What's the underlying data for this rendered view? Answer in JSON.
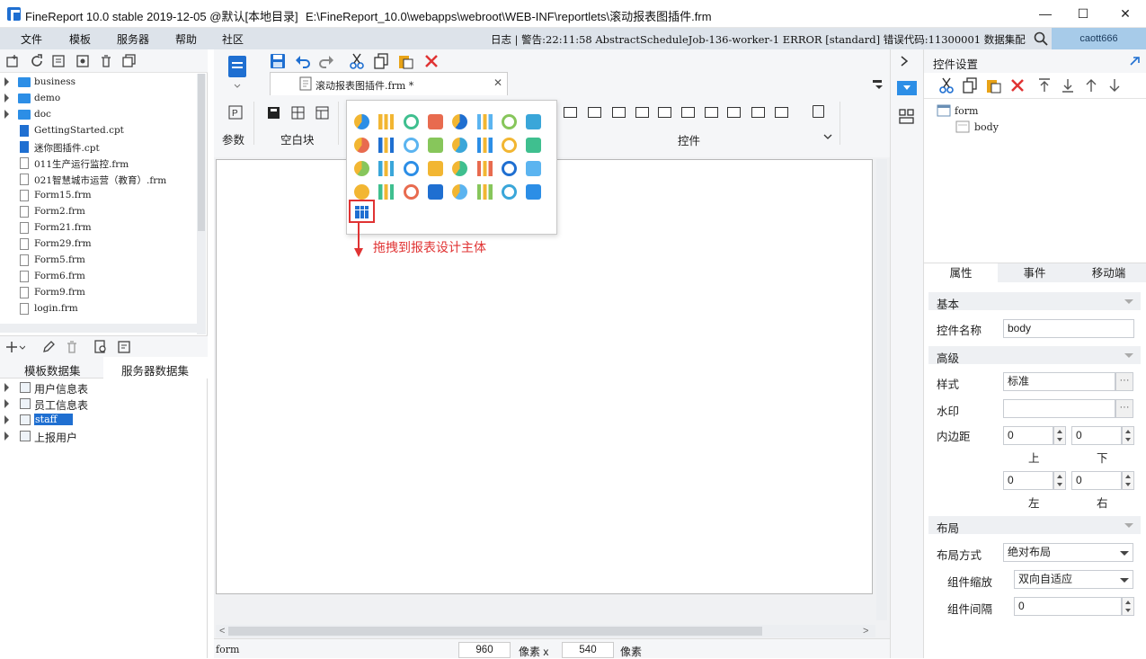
{
  "window": {
    "title": "FineReport 10.0 stable 2019-12-05 @默认[本地目录]",
    "path": "E:\\FineReport_10.0\\webapps\\webroot\\WEB-INF\\reportlets\\滚动报表图插件.frm",
    "min": "—",
    "max": "☐",
    "close": "✕"
  },
  "menubar": {
    "items": [
      "文件",
      "模板",
      "服务器",
      "帮助",
      "社区"
    ],
    "log": "日志 | 警告:22:11:58 AbstractScheduleJob-136-worker-1 ERROR [standard] 错误代码:11300001 数据集配...",
    "user": "caott666"
  },
  "tree": {
    "items": [
      {
        "label": "business",
        "type": "folder"
      },
      {
        "label": "demo",
        "type": "folder"
      },
      {
        "label": "doc",
        "type": "folder"
      },
      {
        "label": "GettingStarted.cpt",
        "type": "cpt"
      },
      {
        "label": "迷你图插件.cpt",
        "type": "cpt"
      },
      {
        "label": "011生产运行监控.frm",
        "type": "frm"
      },
      {
        "label": "021智慧城市运营（教育）.frm",
        "type": "frm"
      },
      {
        "label": "Form15.frm",
        "type": "frm"
      },
      {
        "label": "Form2.frm",
        "type": "frm"
      },
      {
        "label": "Form21.frm",
        "type": "frm"
      },
      {
        "label": "Form29.frm",
        "type": "frm"
      },
      {
        "label": "Form5.frm",
        "type": "frm"
      },
      {
        "label": "Form6.frm",
        "type": "frm"
      },
      {
        "label": "Form9.frm",
        "type": "frm"
      },
      {
        "label": "login.frm",
        "type": "frm"
      }
    ]
  },
  "datasets": {
    "tab_template": "模板数据集",
    "tab_server": "服务器数据集",
    "items": [
      "用户信息表",
      "员工信息表",
      "staff",
      "上报用户"
    ],
    "selected_index": 2
  },
  "editor": {
    "tab_label": "滚动报表图插件.frm *",
    "group_param": "参数",
    "group_blank": "空白块",
    "group_widget": "控件",
    "popup_hint": "拖拽到报表设计主体"
  },
  "bottom": {
    "layer": "form",
    "width": "960",
    "unit1": "像素 x",
    "height": "540",
    "unit2": "像素"
  },
  "rightpanel": {
    "title": "控件设置",
    "tree_root": "form",
    "tree_child": "body",
    "tabs": [
      "属性",
      "事件",
      "移动端"
    ],
    "section_basic": "基本",
    "label_name": "控件名称",
    "value_name": "body",
    "section_adv": "高级",
    "label_style": "样式",
    "value_style": "标准",
    "label_watermark": "水印",
    "value_watermark": "",
    "label_padding": "内边距",
    "pad_top": "0",
    "pad_bottom": "0",
    "pad_left": "0",
    "pad_right": "0",
    "lbl_top": "上",
    "lbl_bottom": "下",
    "lbl_left": "左",
    "lbl_right": "右",
    "section_layout": "布局",
    "label_layout_mode": "布局方式",
    "value_layout_mode": "绝对布局",
    "label_scale": "组件缩放",
    "value_scale": "双向自适应",
    "label_gap": "组件间隔",
    "value_gap": "0",
    "dots": "···"
  },
  "colors": {
    "accent": "#1f6fd1",
    "highlight": "#e03333",
    "user_bg": "#a7cbe9"
  }
}
